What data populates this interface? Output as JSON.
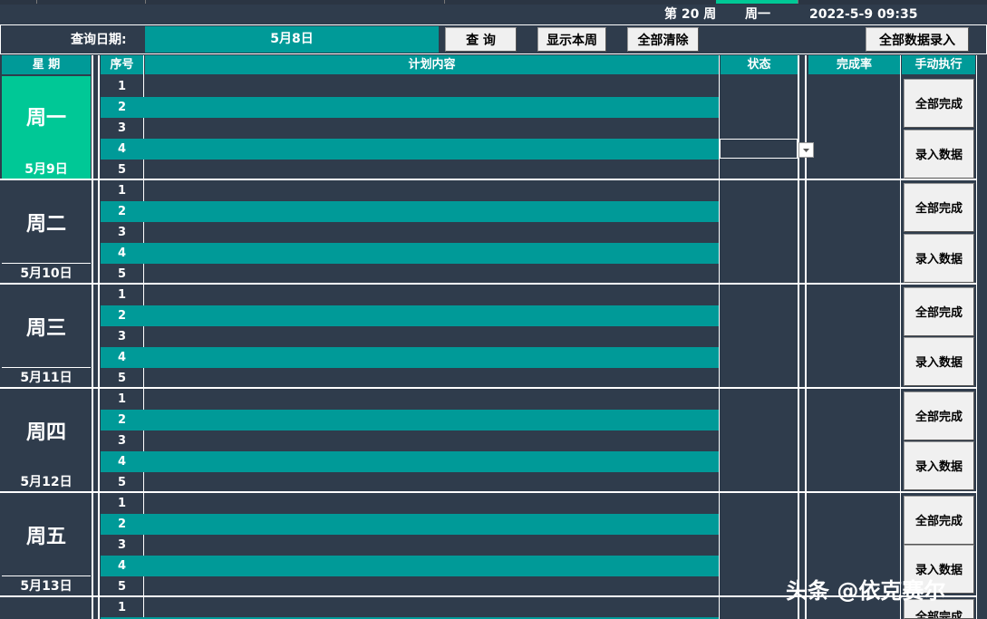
{
  "header": {
    "week_label": "第 20 周",
    "weekday_label": "周一",
    "datetime_label": "2022-5-9 09:35"
  },
  "toolbar": {
    "query_label": "查询日期:",
    "query_date": "5月8日",
    "query_button": "查 询",
    "show_week_button": "显示本周",
    "clear_all_button": "全部清除",
    "enter_all_button": "全部数据录入"
  },
  "columns": {
    "weekday": "星 期",
    "seq": "序号",
    "plan": "计划内容",
    "status": "状态",
    "completion": "完成率",
    "manual": "手动执行"
  },
  "days": [
    {
      "name": "周一",
      "date": "5月9日",
      "rows": [
        "1",
        "2",
        "3",
        "4",
        "5"
      ],
      "complete_button": "全部完成",
      "enter_button": "录入数据"
    },
    {
      "name": "周二",
      "date": "5月10日",
      "rows": [
        "1",
        "2",
        "3",
        "4",
        "5"
      ],
      "complete_button": "全部完成",
      "enter_button": "录入数据"
    },
    {
      "name": "周三",
      "date": "5月11日",
      "rows": [
        "1",
        "2",
        "3",
        "4",
        "5"
      ],
      "complete_button": "全部完成",
      "enter_button": "录入数据"
    },
    {
      "name": "周四",
      "date": "5月12日",
      "rows": [
        "1",
        "2",
        "3",
        "4",
        "5"
      ],
      "complete_button": "全部完成",
      "enter_button": "录入数据"
    },
    {
      "name": "周五",
      "date": "5月13日",
      "rows": [
        "1",
        "2",
        "3",
        "4",
        "5"
      ],
      "complete_button": "全部完成",
      "enter_button": "录入数据"
    }
  ],
  "next_row_num": "1",
  "partial_button": "全部完成",
  "watermark": "头条 @依克赛尔",
  "colors": {
    "background": "#2f3c4c",
    "teal": "#009a98",
    "today": "#00c896"
  }
}
